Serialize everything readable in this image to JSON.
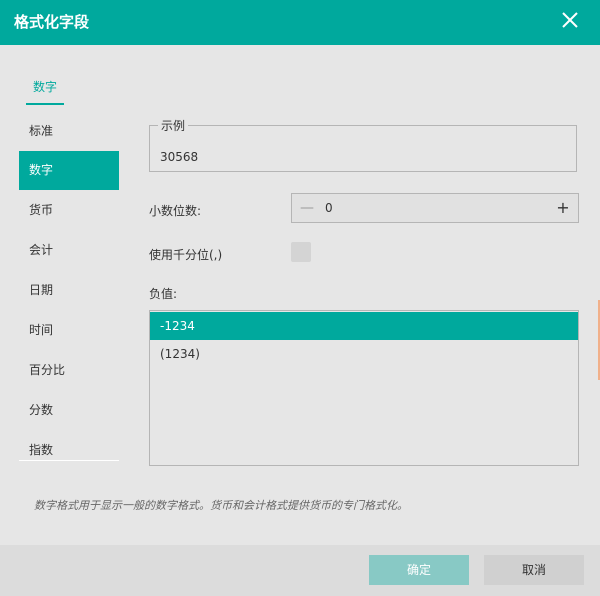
{
  "dialog": {
    "title": "格式化字段",
    "tab": "数字",
    "sidebar": [
      "标准",
      "数字",
      "货币",
      "会计",
      "日期",
      "时间",
      "百分比",
      "分数",
      "指数"
    ],
    "active_index": 1,
    "sample": {
      "legend": "示例",
      "value": "30568"
    },
    "decimal": {
      "label": "小数位数:",
      "minus": "—",
      "value": "0",
      "plus": "+"
    },
    "thousands": {
      "label": "使用千分位(,)"
    },
    "negative": {
      "label": "负值:",
      "options": [
        "-1234",
        "(1234)"
      ],
      "selected_index": 0
    },
    "description": "数字格式用于显示一般的数字格式。货币和会计格式提供货币的专门格式化。",
    "buttons": {
      "ok": "确定",
      "cancel": "取消"
    },
    "colors": {
      "accent": "#00a99d",
      "ok_disabled": "#88c9c5"
    }
  }
}
